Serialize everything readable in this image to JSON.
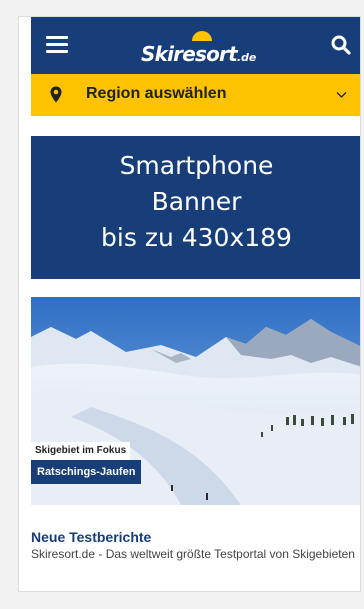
{
  "header": {
    "logo_text": "Skiresort",
    "logo_tld": ".de",
    "menu_icon": "hamburger-menu-icon",
    "search_icon": "search-icon",
    "background": "#173e78"
  },
  "region": {
    "label": "Region auswählen",
    "pin_icon": "map-pin-icon",
    "chevron_icon": "chevron-down-icon",
    "background": "#fdc300"
  },
  "banner": {
    "lines": [
      "Smartphone",
      "Banner",
      "bis zu 430x189"
    ]
  },
  "promo": {
    "kicker": "Skigebiet im Fokus",
    "title": "Ratschings-Jaufen"
  },
  "news": {
    "title": "Neue Testberichte",
    "description": "Skiresort.de - Das weltweit größte Testportal von Skigebieten"
  }
}
